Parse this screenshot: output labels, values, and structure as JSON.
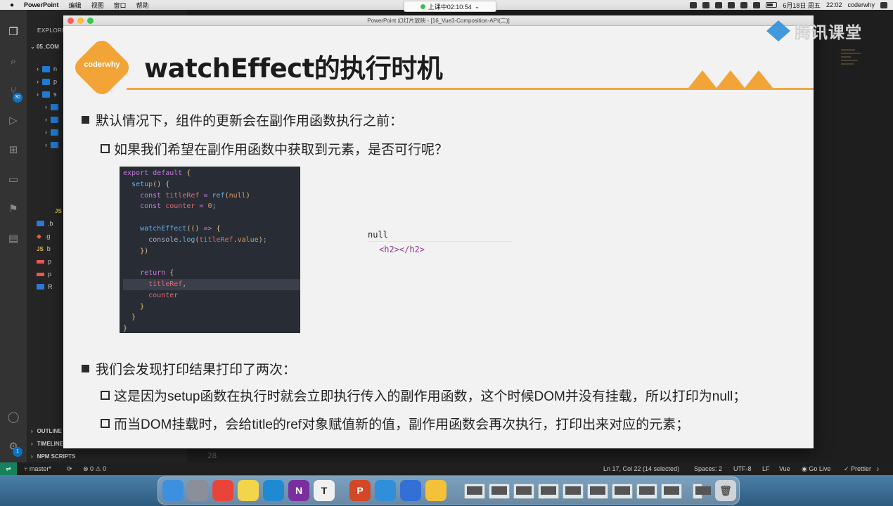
{
  "menubar": {
    "app": "PowerPoint",
    "items": [
      "编辑",
      "视图",
      "窗口",
      "帮助"
    ],
    "date": "6月18日 周五",
    "time": "22:02",
    "user": "coderwhy"
  },
  "class_timer": {
    "text": "上课中02:10:54"
  },
  "watermark": {
    "text": "腾讯课堂"
  },
  "ppt": {
    "window_title": "PowerPoint 幻灯片放映 - [16_Vue3-Composition-API(二)]",
    "logo_text": "coderwhy",
    "title": "watchEffect的执行时机",
    "bullets": [
      "默认情况下，组件的更新会在副作用函数执行之前：",
      "如果我们希望在副作用函数中获取到元素，是否可行呢？",
      "我们会发现打印结果打印了两次：",
      "这是因为setup函数在执行时就会立即执行传入的副作用函数，这个时候DOM并没有挂载，所以打印为null；",
      "而当DOM挂载时，会给title的ref对象赋值新的值，副作用函数会再次执行，打印出来对应的元素；"
    ],
    "code_lines": [
      "export default {",
      "  setup() {",
      "    const titleRef = ref(null)",
      "    const counter = 0;",
      "",
      "    watchEffect(() => {",
      "      console.log(titleRef.value);",
      "    })",
      "",
      "    return {",
      "      titleRef,",
      "      counter",
      "    }",
      "  }",
      "}"
    ],
    "console": {
      "line1": "null",
      "line2": "<h2></h2>"
    }
  },
  "vscode": {
    "explorer_header": "EXPLORER",
    "project": "05_COM",
    "sections": [
      "OUTLINE",
      "TIMELINE",
      "NPM SCRIPTS"
    ],
    "source_control_badge": "30",
    "settings_badge": "1",
    "line_number": "28",
    "tree": [
      {
        "name": "n",
        "type": "folder"
      },
      {
        "name": "p",
        "type": "folder"
      },
      {
        "name": "s",
        "type": "folder"
      },
      {
        "name": "",
        "type": "folder"
      },
      {
        "name": "",
        "type": "folder"
      },
      {
        "name": "",
        "type": "folder"
      },
      {
        "name": "",
        "type": "folder"
      },
      {
        "name": "JS",
        "type": "js"
      },
      {
        "name": ".b",
        "type": "file"
      },
      {
        "name": ".g",
        "type": "git"
      },
      {
        "name": "b",
        "type": "js"
      },
      {
        "name": "p",
        "type": "pkg"
      },
      {
        "name": "p",
        "type": "pkg"
      },
      {
        "name": "R",
        "type": "md"
      }
    ]
  },
  "statusbar": {
    "branch": "master*",
    "problems": "⊗ 0 ⚠ 0",
    "position": "Ln 17, Col 22 (14 selected)",
    "spaces": "Spaces: 2",
    "encoding": "UTF-8",
    "eol": "LF",
    "language": "Vue",
    "golive": "Go Live",
    "prettier": "Prettier"
  },
  "dock": {
    "apps": [
      {
        "name": "finder-icon",
        "color": "#3d8fe0",
        "glyph": ""
      },
      {
        "name": "launchpad-icon",
        "color": "#8a8f99",
        "glyph": ""
      },
      {
        "name": "chrome-icon",
        "color": "#e9443a",
        "glyph": ""
      },
      {
        "name": "notes-icon",
        "color": "#f2d54a",
        "glyph": ""
      },
      {
        "name": "vscode-icon",
        "color": "#1f8ad2",
        "glyph": ""
      },
      {
        "name": "onenote-icon",
        "color": "#7b2f9f",
        "glyph": "N"
      },
      {
        "name": "typora-icon",
        "color": "#f0f0f0",
        "glyph": "T"
      },
      {
        "name": "powerpoint-icon",
        "color": "#d24726",
        "glyph": "P"
      },
      {
        "name": "tencent-class-icon",
        "color": "#2f8fd8",
        "glyph": ""
      },
      {
        "name": "screen-capture-icon",
        "color": "#3370d6",
        "glyph": ""
      },
      {
        "name": "wps-icon",
        "color": "#f3c23a",
        "glyph": ""
      }
    ]
  }
}
